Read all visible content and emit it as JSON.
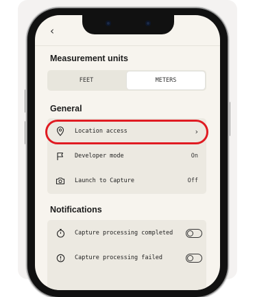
{
  "screen": {
    "back_icon": "chevron-left-icon",
    "back_glyph": "‹"
  },
  "measurement": {
    "title": "Measurement units",
    "options": [
      "FEET",
      "METERS"
    ],
    "selected": "METERS"
  },
  "general": {
    "title": "General",
    "items": [
      {
        "label": "Location access",
        "icon": "location-pin-icon",
        "value": "",
        "chevron": "›"
      },
      {
        "label": "Developer mode",
        "icon": "flag-icon",
        "value": "On"
      },
      {
        "label": "Launch to Capture",
        "icon": "camera-icon",
        "value": "Off"
      }
    ]
  },
  "notifications": {
    "title": "Notifications",
    "items": [
      {
        "label": "Capture processing completed",
        "icon": "stopwatch-icon",
        "enabled": false
      },
      {
        "label": "Capture processing failed",
        "icon": "alert-circle-icon",
        "enabled": false
      }
    ]
  },
  "colors": {
    "highlight": "#e01b22",
    "screen_bg": "#f7f4ee",
    "group_bg": "#ece9e1"
  }
}
